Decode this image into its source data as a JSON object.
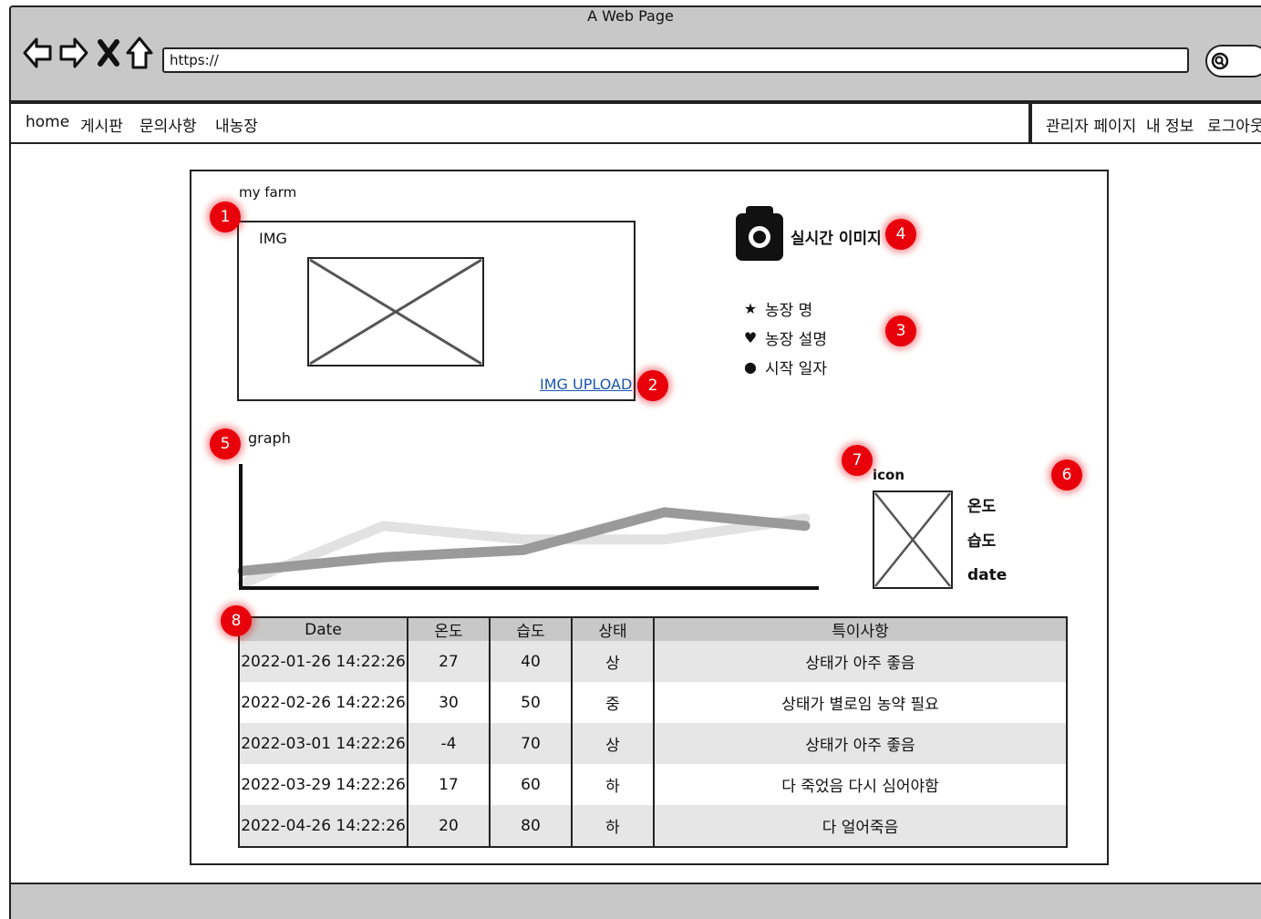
{
  "window": {
    "title": "A Web Page"
  },
  "address_bar": {
    "url": "https://"
  },
  "nav_menu": {
    "items": [
      "home",
      "게시판",
      "문의사항",
      "내농장"
    ]
  },
  "user_menu": {
    "items": [
      "관리자 페이지",
      "내 정보",
      "로그아웃"
    ]
  },
  "farm": {
    "section_label": "my farm",
    "image_label": "IMG",
    "upload_link": "IMG UPLOAD",
    "realtime_label": "실시간 이미지",
    "info": [
      {
        "icon": "star-icon",
        "label": "농장 명"
      },
      {
        "icon": "heart-icon",
        "label": "농장 설명"
      },
      {
        "icon": "circle-icon",
        "label": "시작 일자"
      }
    ]
  },
  "graph": {
    "label": "graph"
  },
  "chart_data": {
    "type": "line",
    "x": [
      0,
      1,
      2,
      3,
      4
    ],
    "series": [
      {
        "values": [
          0.12,
          0.25,
          0.32,
          0.68,
          0.55
        ],
        "color": "#9a9a9a"
      },
      {
        "values": [
          0.0,
          0.55,
          0.42,
          0.42,
          0.62
        ],
        "color": "#e2e2e2"
      }
    ],
    "ylim": [
      0,
      1
    ]
  },
  "sensor": {
    "icon_label": "icon",
    "labels": [
      "온도",
      "습도",
      "date"
    ]
  },
  "markers": [
    "1",
    "2",
    "3",
    "4",
    "5",
    "6",
    "7",
    "8"
  ],
  "table": {
    "headers": [
      "Date",
      "온도",
      "습도",
      "상태",
      "특이사항"
    ],
    "rows": [
      [
        "2022-01-26 14:22:26",
        "27",
        "40",
        "상",
        "상태가 아주 좋음"
      ],
      [
        "2022-02-26 14:22:26",
        "30",
        "50",
        "중",
        "상태가 별로임 농약 필요"
      ],
      [
        "2022-03-01 14:22:26",
        "-4",
        "70",
        "상",
        "상태가 아주 좋음"
      ],
      [
        "2022-03-29 14:22:26",
        "17",
        "60",
        "하",
        "다 죽었음 다시 심어야함"
      ],
      [
        "2022-04-26 14:22:26",
        "20",
        "80",
        "하",
        "다 얼어죽음"
      ]
    ]
  }
}
